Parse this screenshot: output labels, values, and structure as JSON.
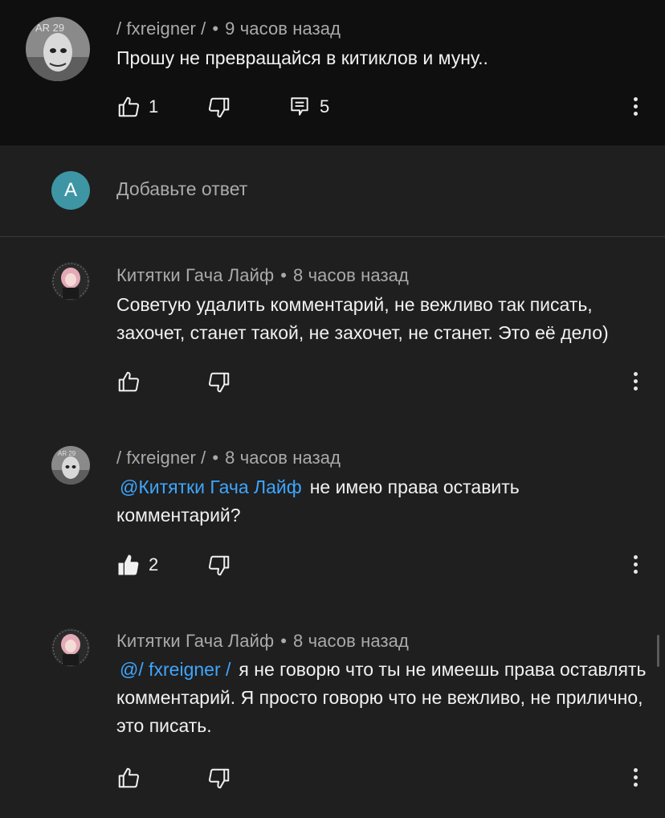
{
  "colors": {
    "background": "#1f1f1f",
    "top_background": "#0f0f0f",
    "mention": "#3ea6ff",
    "reply_avatar": "#3e96a4"
  },
  "top_comment": {
    "author": "/ fxreigner /",
    "time": "9 часов назад",
    "text": "Прошу не превращайся в китиклов и муну..",
    "likes": "1",
    "replies": "5"
  },
  "reply_input": {
    "avatar_letter": "A",
    "placeholder": "Добавьте ответ"
  },
  "replies": [
    {
      "author": "Китятки Гача Лайф",
      "time": "8 часов назад",
      "mention": "",
      "text": "Советую удалить комментарий, не вежливо так писать, захочет, станет такой, не захочет, не станет. Это её дело)",
      "likes": "",
      "liked": false
    },
    {
      "author": "/ fxreigner /",
      "time": "8 часов назад",
      "mention": "@Китятки Гача Лайф",
      "text": "не имею права оставить комментарий?",
      "likes": "2",
      "liked": true
    },
    {
      "author": "Китятки Гача Лайф",
      "time": "8 часов назад",
      "mention": "@/ fxreigner /",
      "text": "я не говорю что ты не имеешь права оставлять комментарий. Я просто говорю что не вежливо, не прилично, это писать.",
      "likes": "",
      "liked": false
    }
  ],
  "icons": {
    "like": "thumb-up-icon",
    "like_filled": "thumb-up-filled-icon",
    "dislike": "thumb-down-icon",
    "replies": "comment-replies-icon",
    "more": "more-vertical-icon"
  }
}
